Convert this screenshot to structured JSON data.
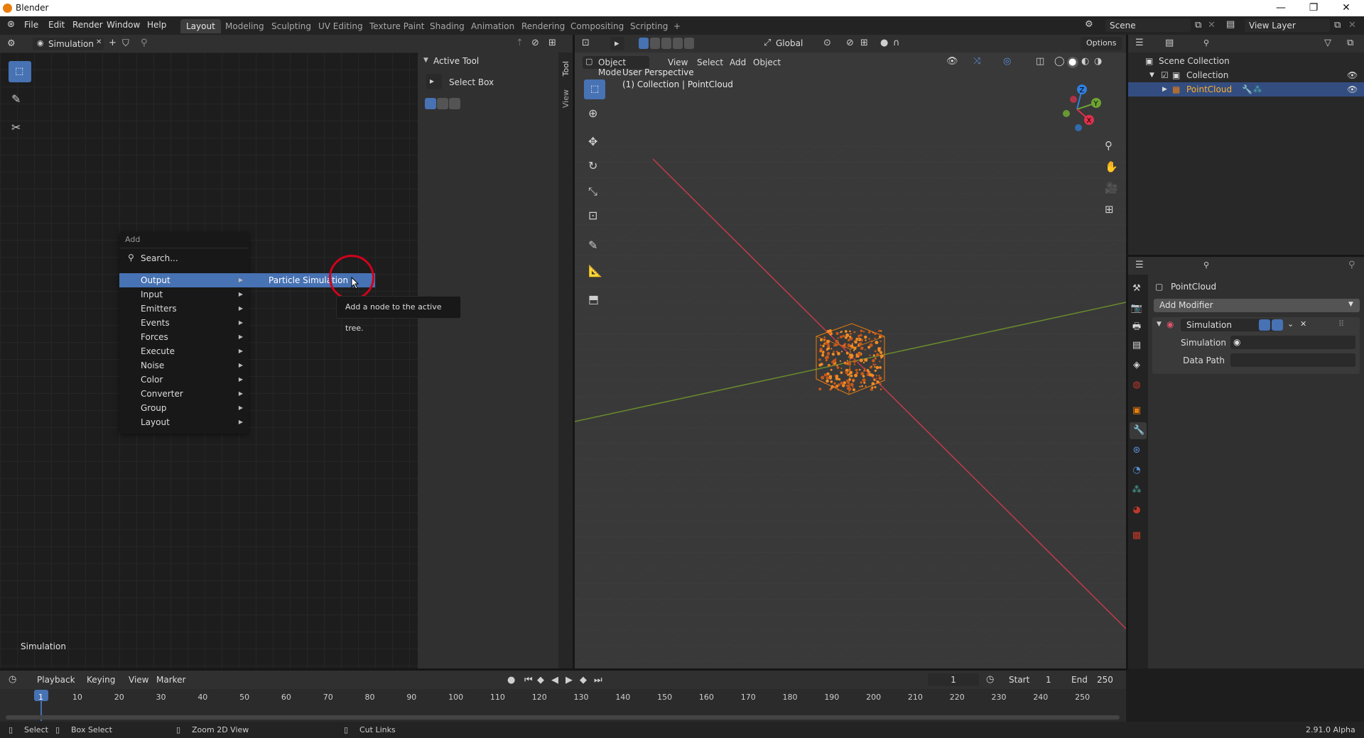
{
  "window": {
    "title": "Blender",
    "controls": [
      "—",
      "❐",
      "✕"
    ]
  },
  "topbar": {
    "menus": [
      "File",
      "Edit",
      "Render",
      "Window",
      "Help"
    ],
    "workspaces": [
      "Layout",
      "Modeling",
      "Sculpting",
      "UV Editing",
      "Texture Paint",
      "Shading",
      "Animation",
      "Rendering",
      "Compositing",
      "Scripting"
    ],
    "active_workspace": "Layout",
    "add_workspace": "+",
    "scene": "Scene",
    "view_layer": "View Layer"
  },
  "node_editor": {
    "tree_name": "Simulation",
    "corner_label": "Simulation",
    "sidebar_tabs": [
      "Tool",
      "View"
    ],
    "active_tool_header": "Active Tool",
    "active_tool_name": "Select Box"
  },
  "add_menu": {
    "title": "Add",
    "search": "Search...",
    "items": [
      "Output",
      "Input",
      "Emitters",
      "Events",
      "Forces",
      "Execute",
      "Noise",
      "Color",
      "Converter",
      "Group",
      "Layout"
    ],
    "highlighted": "Output",
    "submenu_item": "Particle Simulation",
    "tooltip": "Add a node to the active tree."
  },
  "viewport": {
    "mode": "Object Mode",
    "menus": [
      "View",
      "Select",
      "Add",
      "Object"
    ],
    "orientation": "Global",
    "options": "Options",
    "perspective": "User Perspective",
    "collection_info": "(1) Collection | PointCloud",
    "gizmo_axes": [
      "Z",
      "Y",
      "X"
    ]
  },
  "outliner": {
    "scene_collection": "Scene Collection",
    "collection": "Collection",
    "object": "PointCloud"
  },
  "properties": {
    "object_name": "PointCloud",
    "add_modifier": "Add Modifier",
    "modifier_name": "Simulation",
    "field_simulation_label": "Simulation",
    "field_data_path_label": "Data Path"
  },
  "timeline": {
    "menus": [
      "Playback",
      "Keying",
      "View",
      "Marker"
    ],
    "current_frame": "1",
    "start_label": "Start",
    "start_value": "1",
    "end_label": "End",
    "end_value": "250",
    "ticks": [
      "1",
      "10",
      "20",
      "30",
      "40",
      "50",
      "60",
      "70",
      "80",
      "90",
      "100",
      "110",
      "120",
      "130",
      "140",
      "150",
      "160",
      "170",
      "180",
      "190",
      "200",
      "210",
      "220",
      "230",
      "240",
      "250"
    ]
  },
  "statusbar": {
    "items": [
      "Select",
      "Box Select",
      "Zoom 2D View",
      "Cut Links"
    ],
    "version": "2.91.0 Alpha"
  },
  "colors": {
    "accent": "#4772b3",
    "highlight_orange": "#e87d0d",
    "cursor_ring": "#d0021b"
  }
}
